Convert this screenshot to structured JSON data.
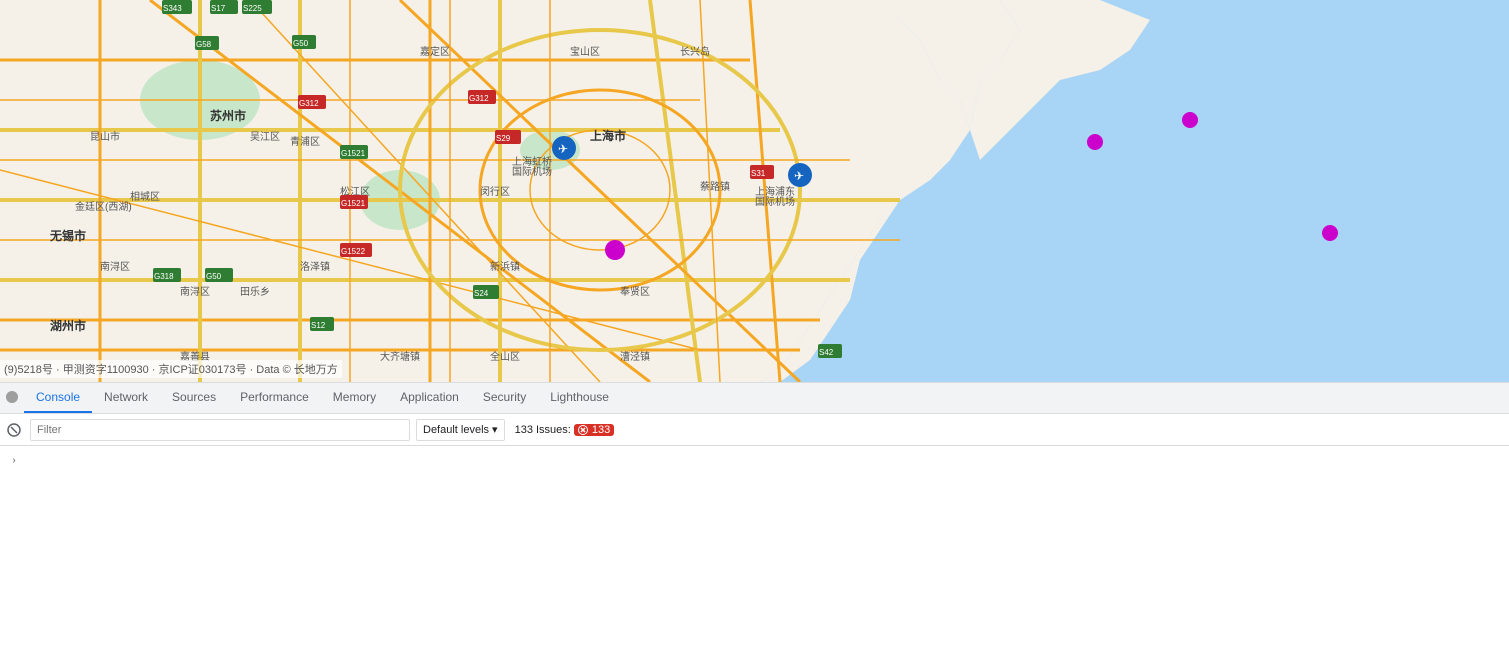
{
  "map": {
    "attribution": "(9)5218号 · 甲测资字1100930 · 京ICP证030173号 · Data © 长地万方"
  },
  "devtools": {
    "tabs": [
      {
        "id": "console",
        "label": "Console",
        "active": true
      },
      {
        "id": "network",
        "label": "Network",
        "active": false
      },
      {
        "id": "sources",
        "label": "Sources",
        "active": false
      },
      {
        "id": "performance",
        "label": "Performance",
        "active": false
      },
      {
        "id": "memory",
        "label": "Memory",
        "active": false
      },
      {
        "id": "application",
        "label": "Application",
        "active": false
      },
      {
        "id": "security",
        "label": "Security",
        "active": false
      },
      {
        "id": "lighthouse",
        "label": "Lighthouse",
        "active": false
      }
    ]
  },
  "console_toolbar": {
    "filter_placeholder": "Filter",
    "filter_value": "",
    "default_levels_label": "Default levels",
    "issues_label": "133 Issues:",
    "issues_count": "133"
  },
  "icons": {
    "circle": "●",
    "chevron_down": "▾",
    "error": "⊗",
    "expand": "›",
    "ban": "🚫"
  }
}
